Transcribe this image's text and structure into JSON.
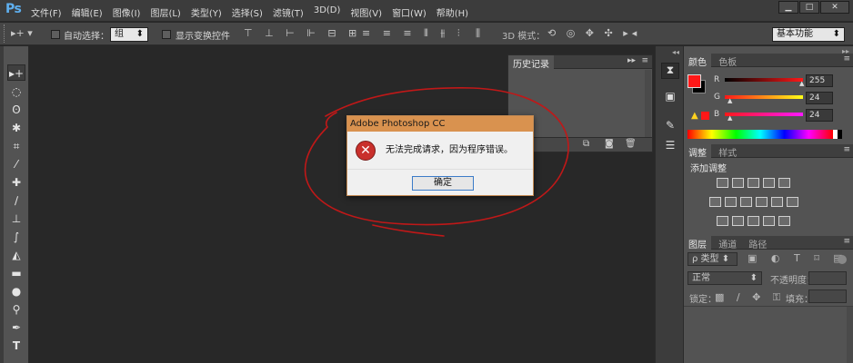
{
  "app": {
    "logo": "Ps"
  },
  "menu": [
    "文件(F)",
    "编辑(E)",
    "图像(I)",
    "图层(L)",
    "类型(Y)",
    "选择(S)",
    "滤镜(T)",
    "3D(D)",
    "视图(V)",
    "窗口(W)",
    "帮助(H)"
  ],
  "window_controls": [
    "minimize",
    "maximize",
    "close"
  ],
  "options": {
    "auto_select_label": "自动选择：",
    "auto_select_value": "组",
    "show_transform_label": "显示变换控件",
    "mode_3d_label": "3D 模式：",
    "workspace": "基本功能"
  },
  "history_panel": {
    "tab": "历史记录"
  },
  "color_panel": {
    "tabs": [
      "颜色",
      "色板"
    ],
    "r_label": "R",
    "g_label": "G",
    "b_label": "B",
    "r_value": "255",
    "g_value": "24",
    "b_value": "24",
    "foreground_color": "#ff1818",
    "background_color": "#000000"
  },
  "adjust_panel": {
    "tabs": [
      "调整",
      "样式"
    ],
    "add_label": "添加调整"
  },
  "layers_panel": {
    "tabs": [
      "图层",
      "通道",
      "路径"
    ],
    "filter_label": "ρ 类型",
    "blend_mode": "正常",
    "opacity_label": "不透明度：",
    "lock_label": "锁定：",
    "fill_label": "填充："
  },
  "dialog": {
    "title": "Adobe Photoshop CC",
    "message": "无法完成请求，因为程序错误。",
    "ok": "确定"
  },
  "colors": {
    "annotation_red": "#c01818",
    "ps_blue": "#5fb0f0",
    "dialog_title": "#d9924f"
  }
}
